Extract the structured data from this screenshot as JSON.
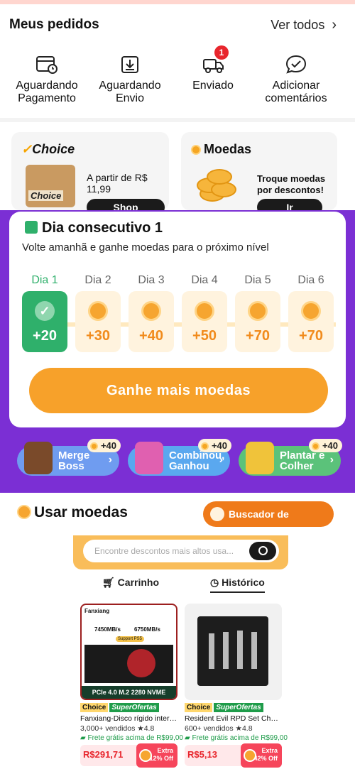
{
  "orders": {
    "title": "Meus pedidos",
    "see_all": "Ver todos",
    "items": [
      {
        "label": "Aguardando\nPagamento",
        "icon": "wallet-clock-icon"
      },
      {
        "label": "Aguardando\nEnvio",
        "icon": "package-download-icon"
      },
      {
        "label": "Enviado",
        "icon": "truck-icon",
        "badge": "1"
      },
      {
        "label": "Adicionar\ncomentários",
        "icon": "chat-check-icon"
      }
    ]
  },
  "promo_cards": {
    "choice": {
      "title": "Choice",
      "text": "A partir de R$ 11,99",
      "button": "Shop",
      "box_text": "Choice"
    },
    "coins": {
      "title": "Moedas",
      "text": "Troque moedas por descontos!",
      "button": "Ir"
    }
  },
  "streak": {
    "title": "Dia consecutivo 1",
    "subtitle": "Volte amanhã e ganhe moedas para o próximo nível",
    "days": [
      {
        "label": "Dia 1",
        "amount": "+20",
        "state": "done"
      },
      {
        "label": "Dia 2",
        "amount": "+30",
        "state": "pending"
      },
      {
        "label": "Dia 3",
        "amount": "+40",
        "state": "pending"
      },
      {
        "label": "Dia 4",
        "amount": "+50",
        "state": "pending"
      },
      {
        "label": "Dia 5",
        "amount": "+70",
        "state": "pending"
      },
      {
        "label": "Dia 6",
        "amount": "+70",
        "state": "pending"
      }
    ],
    "earn_button": "Ganhe mais moedas"
  },
  "games": [
    {
      "name": "Merge Boss",
      "bonus": "+40",
      "color": "#6f9cf0"
    },
    {
      "name": "Combinou, Ganhou",
      "bonus": "+40",
      "color": "#5aa8ef"
    },
    {
      "name": "Plantar e Colher",
      "bonus": "+40",
      "color": "#5bc27a"
    }
  ],
  "use_coins": {
    "title": "Usar moedas",
    "finder_button": "Buscador de descontos",
    "search_placeholder": "Encontre descontos mais altos usa...",
    "tabs": [
      {
        "label": "Carrinho",
        "icon": "cart-icon"
      },
      {
        "label": "Histórico",
        "icon": "clock-icon",
        "active": true
      }
    ]
  },
  "products": [
    {
      "title": "Fanxiang-Disco rígido interno d...",
      "brand": "Fanxiang",
      "read_speed": "7450MB/s",
      "write_speed": "6750MB/s",
      "ps5": "Support PS5",
      "banner": "PCIe 4.0 M.2 2280 NVME",
      "tag_choice": "Choice",
      "tag_super": "SuperOfertas",
      "sold": "3,000+ vendidos",
      "rating": "4.8",
      "shipping": "Frete grátis acima de R$99,00",
      "price": "R$291,71",
      "deal_top": "Extra",
      "deal_bottom": "12% Off"
    },
    {
      "title": "Resident Evil RPD Set Chave, R...",
      "tag_choice": "Choice",
      "tag_super": "SuperOfertas",
      "sold": "600+ vendidos",
      "rating": "4.8",
      "shipping": "Frete grátis acima de R$99,00",
      "price": "R$5,13",
      "deal_top": "Extra",
      "deal_bottom": "42% Off"
    }
  ]
}
